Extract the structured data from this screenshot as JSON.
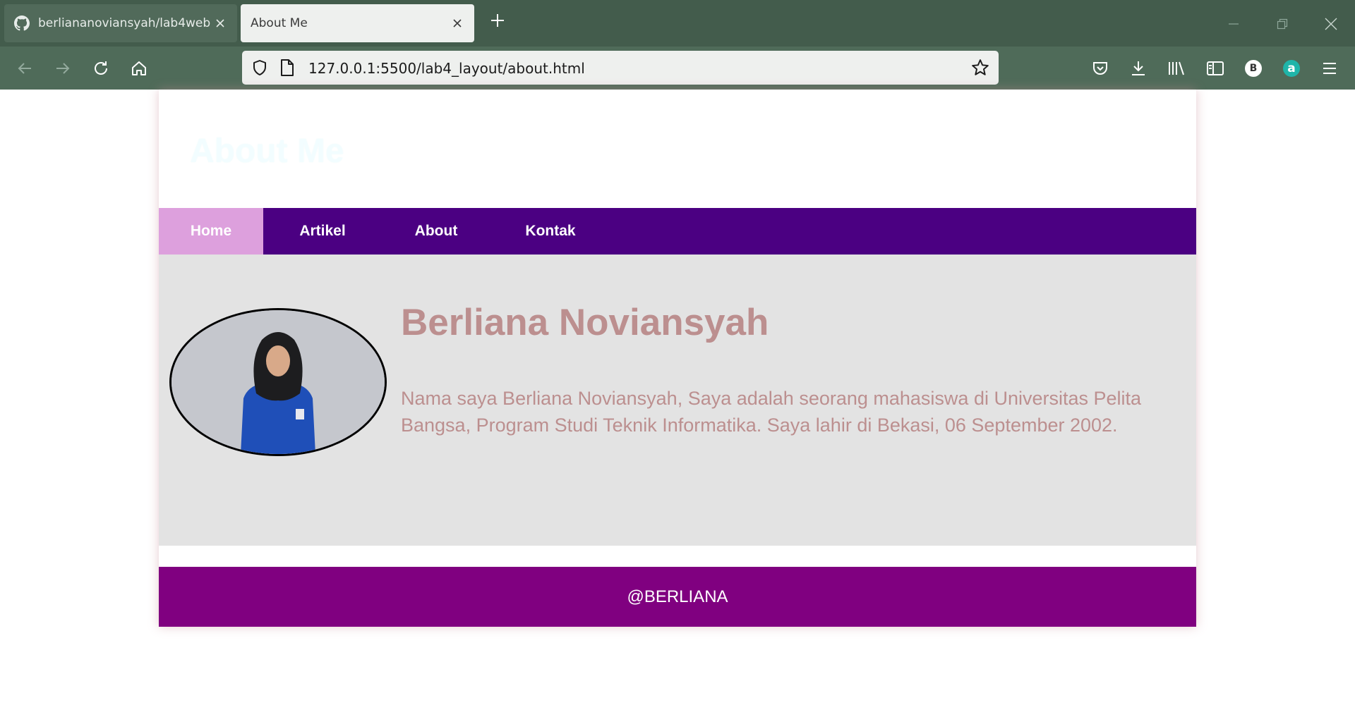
{
  "browser": {
    "tabs": [
      {
        "title": "berliananoviansyah/lab4web",
        "icon": "github-icon",
        "active": false
      },
      {
        "title": "About Me",
        "active": true
      }
    ],
    "url": {
      "host": "127.0.0.1",
      "rest": ":5500/lab4_layout/about.html"
    },
    "profile_badge": "B",
    "extension_badge": "a"
  },
  "site": {
    "title": "About Me",
    "nav": [
      {
        "label": "Home",
        "active": true
      },
      {
        "label": "Artikel",
        "active": false
      },
      {
        "label": "About",
        "active": false
      },
      {
        "label": "Kontak",
        "active": false
      }
    ],
    "profile": {
      "name": "Berliana Noviansyah",
      "bio": "Nama saya Berliana Noviansyah, Saya adalah seorang mahasiswa di Universitas Pelita Bangsa, Program Studi Teknik Informatika. Saya lahir di Bekasi, 06 September 2002."
    },
    "footer": "@BERLIANA"
  },
  "colors": {
    "chrome_dark": "#435c4c",
    "chrome_toolbar": "#4f6b59",
    "nav_bg": "#4b0082",
    "nav_active": "#dda0dd",
    "content_bg": "#e3e3e3",
    "text_accent": "#bc8f8f",
    "footer_bg": "#800080"
  }
}
